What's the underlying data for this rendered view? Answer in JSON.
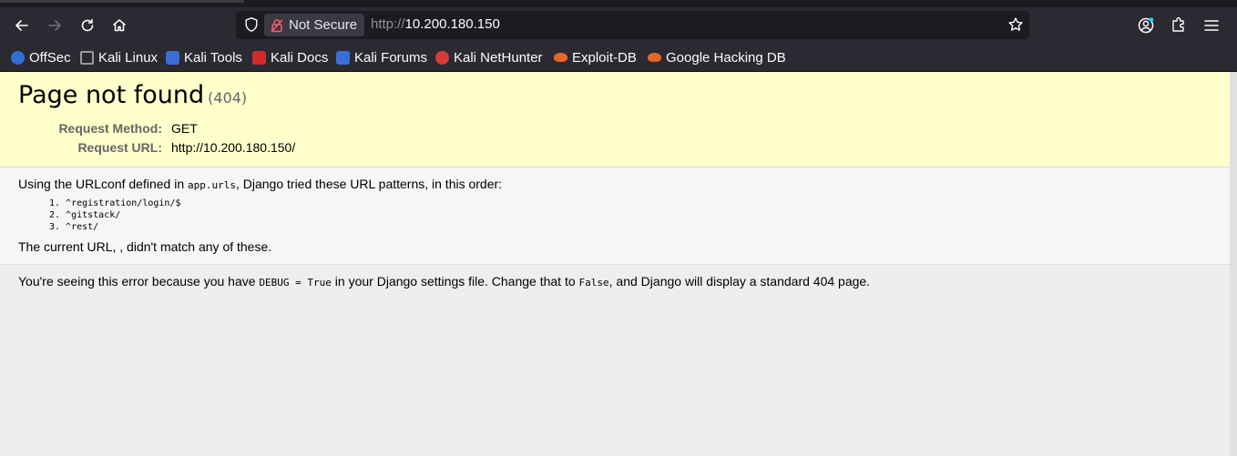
{
  "browser": {
    "not_secure_label": "Not Secure",
    "url_prefix": "http://",
    "url_host": "10.200.180.150",
    "bookmarks": [
      {
        "label": "OffSec",
        "color": "#2f6fd6"
      },
      {
        "label": "Kali Linux",
        "color": "#8a8a8a"
      },
      {
        "label": "Kali Tools",
        "color": "#3a6fd8"
      },
      {
        "label": "Kali Docs",
        "color": "#d02c2c"
      },
      {
        "label": "Kali Forums",
        "color": "#3a6fd8"
      },
      {
        "label": "Kali NetHunter",
        "color": "#d83a3a"
      },
      {
        "label": "Exploit-DB",
        "color": "#e8662a"
      },
      {
        "label": "Google Hacking DB",
        "color": "#e8662a"
      }
    ]
  },
  "error": {
    "title": "Page not found",
    "status_code": "(404)",
    "request_method_label": "Request Method:",
    "request_method": "GET",
    "request_url_label": "Request URL:",
    "request_url": "http://10.200.180.150/",
    "urlconf_prefix": "Using the URLconf defined in ",
    "urlconf_module": "app.urls",
    "urlconf_suffix": ", Django tried these URL patterns, in this order:",
    "patterns": [
      "1. ^registration/login/$",
      "2. ^gitstack/",
      "3. ^rest/"
    ],
    "no_match": "The current URL, , didn't match any of these.",
    "explain_1": "You're seeing this error because you have ",
    "explain_code_1": "DEBUG = True",
    "explain_2": " in your Django settings file. Change that to ",
    "explain_code_2": "False",
    "explain_3": ", and Django will display a standard 404 page."
  },
  "colors": {
    "summary_bg": "#ffffcc",
    "chrome_bg": "#2b2a33"
  }
}
